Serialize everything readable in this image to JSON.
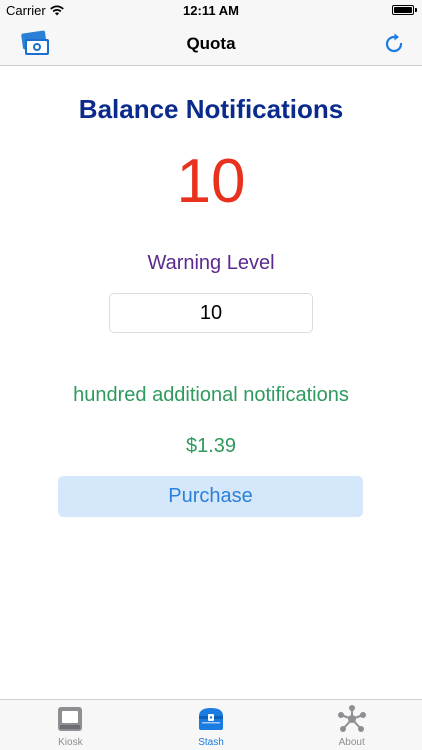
{
  "status_bar": {
    "carrier": "Carrier",
    "time": "12:11 AM"
  },
  "nav": {
    "title": "Quota",
    "left_icon": "money-icon",
    "right_icon": "refresh-icon"
  },
  "main": {
    "title": "Balance Notifications",
    "count": "10",
    "warning_label": "Warning Level",
    "warning_value": "10",
    "description": "hundred additional notifications",
    "price": "$1.39",
    "purchase_label": "Purchase"
  },
  "tabs": [
    {
      "label": "Kiosk",
      "icon": "kiosk-icon",
      "active": false
    },
    {
      "label": "Stash",
      "icon": "treasure-chest-icon",
      "active": true
    },
    {
      "label": "About",
      "icon": "network-icon",
      "active": false
    }
  ],
  "colors": {
    "title": "#0b2b8c",
    "count": "#e8321e",
    "warning_label": "#5a2a8e",
    "green_text": "#2e9a5e",
    "accent": "#1a7be0",
    "button_bg": "#d5e8fb"
  }
}
